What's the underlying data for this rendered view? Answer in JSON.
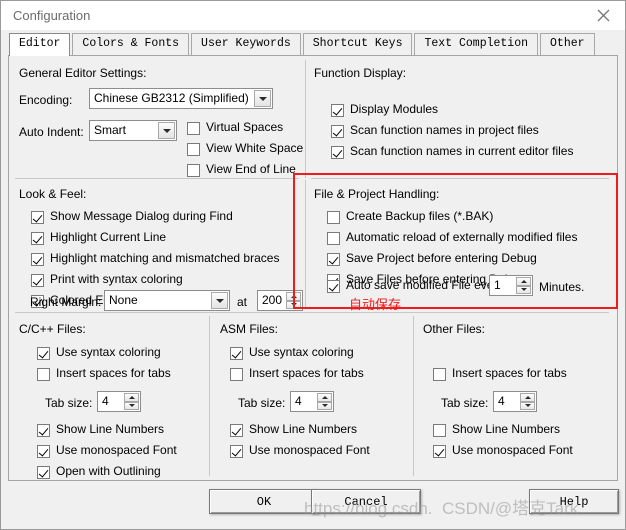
{
  "window": {
    "title": "Configuration",
    "close_icon": "close-icon"
  },
  "tabs": [
    {
      "label": "Editor",
      "active": true
    },
    {
      "label": "Colors & Fonts",
      "active": false
    },
    {
      "label": "User Keywords",
      "active": false
    },
    {
      "label": "Shortcut Keys",
      "active": false
    },
    {
      "label": "Text Completion",
      "active": false
    },
    {
      "label": "Other",
      "active": false
    }
  ],
  "general_editor": {
    "group_label": "General Editor Settings:",
    "encoding_label": "Encoding:",
    "encoding_value": "Chinese GB2312 (Simplified)",
    "auto_indent_label": "Auto Indent:",
    "auto_indent_value": "Smart",
    "checkboxes": [
      {
        "label": "Virtual Spaces",
        "checked": false
      },
      {
        "label": "View White Space",
        "checked": false
      },
      {
        "label": "View End of Line",
        "checked": false
      }
    ]
  },
  "look_and_feel": {
    "group_label": "Look & Feel:",
    "checkboxes": [
      {
        "label": "Show Message Dialog during Find",
        "checked": true
      },
      {
        "label": "Highlight Current Line",
        "checked": true
      },
      {
        "label": "Highlight matching and mismatched braces",
        "checked": true
      },
      {
        "label": "Print with syntax coloring",
        "checked": true
      },
      {
        "label": "Colored Editor Tabs",
        "checked": true
      }
    ],
    "right_margin_label": "Right Margin:",
    "right_margin_value": "None",
    "at_label": "at",
    "at_value": "200"
  },
  "function_display": {
    "group_label": "Function Display:",
    "checkboxes": [
      {
        "label": "Display Modules",
        "checked": true
      },
      {
        "label": "Scan function names in project files",
        "checked": true
      },
      {
        "label": "Scan function names in current editor files",
        "checked": true
      }
    ]
  },
  "file_project": {
    "group_label": "File & Project Handling:",
    "checkboxes": [
      {
        "label": "Create Backup files (*.BAK)",
        "checked": false
      },
      {
        "label": "Automatic reload of externally modified files",
        "checked": false
      },
      {
        "label": "Save Project before entering Debug",
        "checked": true
      },
      {
        "label": "Save Files before entering Debug",
        "checked": true
      },
      {
        "label": "Auto save modified File every",
        "checked": true
      }
    ],
    "autosave_minutes": "1",
    "minutes_label": "Minutes.",
    "annotation_text": "自动保存",
    "annotation_color": "#ef1c1c"
  },
  "c_files": {
    "group_label": "C/C++ Files:",
    "checkboxes": [
      {
        "label": "Use syntax coloring",
        "checked": true
      },
      {
        "label": "Insert spaces for tabs",
        "checked": false
      }
    ],
    "tab_size_label": "Tab size:",
    "tab_size_value": "4",
    "checkboxes2": [
      {
        "label": "Show Line Numbers",
        "checked": true
      },
      {
        "label": "Use monospaced Font",
        "checked": true
      },
      {
        "label": "Open with Outlining",
        "checked": true
      }
    ]
  },
  "asm_files": {
    "group_label": "ASM Files:",
    "checkboxes": [
      {
        "label": "Use syntax coloring",
        "checked": true
      },
      {
        "label": "Insert spaces for tabs",
        "checked": false
      }
    ],
    "tab_size_label": "Tab size:",
    "tab_size_value": "4",
    "checkboxes2": [
      {
        "label": "Show Line Numbers",
        "checked": true
      },
      {
        "label": "Use monospaced Font",
        "checked": true
      }
    ]
  },
  "other_files": {
    "group_label": "Other Files:",
    "checkboxes": [
      {
        "label": "Insert spaces for tabs",
        "checked": false
      }
    ],
    "tab_size_label": "Tab size:",
    "tab_size_value": "4",
    "checkboxes2": [
      {
        "label": "Show Line Numbers",
        "checked": false
      },
      {
        "label": "Use monospaced Font",
        "checked": true
      }
    ]
  },
  "footer": {
    "ok_label": "OK",
    "cancel_label": "Cancel",
    "help_label": "Help"
  },
  "watermark": {
    "url": "https://blog.csdn.",
    "handle": "CSDN/@塔克Tark"
  }
}
